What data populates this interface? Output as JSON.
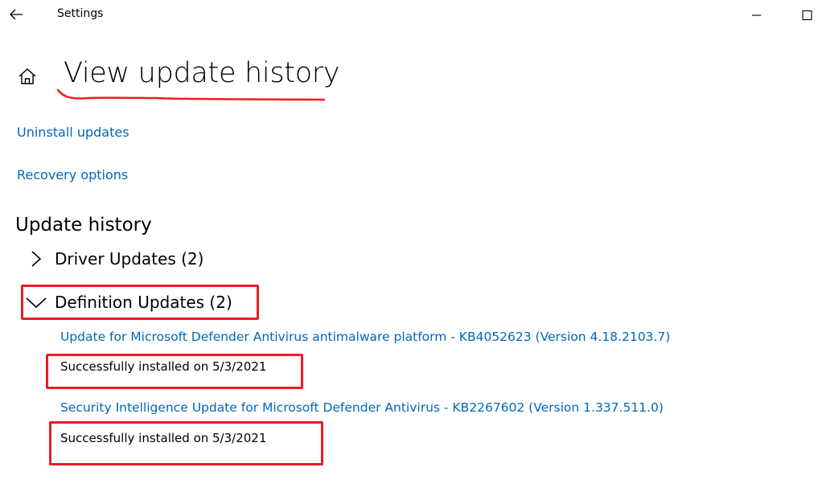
{
  "titlebar": {
    "title": "Settings",
    "icons": {
      "back": "back-arrow-icon",
      "minimize": "minimize-icon",
      "maximize": "maximize-icon"
    }
  },
  "header": {
    "home_icon": "home-icon",
    "title": "View update history"
  },
  "links": {
    "uninstall": "Uninstall updates",
    "recovery": "Recovery options"
  },
  "history": {
    "section_title": "Update history",
    "groups": [
      {
        "label": "Driver Updates (2)",
        "expanded": false
      },
      {
        "label": "Definition Updates (2)",
        "expanded": true,
        "items": [
          {
            "title": "Update for Microsoft Defender Antivirus antimalware platform - KB4052623 (Version 4.18.2103.7)",
            "status": "Successfully installed on 5/3/2021"
          },
          {
            "title": "Security Intelligence Update for Microsoft Defender Antivirus - KB2267602 (Version 1.337.511.0)",
            "status": "Successfully installed on 5/3/2021"
          }
        ]
      }
    ]
  },
  "colors": {
    "link": "#0067b8",
    "annotation": "#ec1c24",
    "text": "#000000",
    "background": "#ffffff"
  }
}
